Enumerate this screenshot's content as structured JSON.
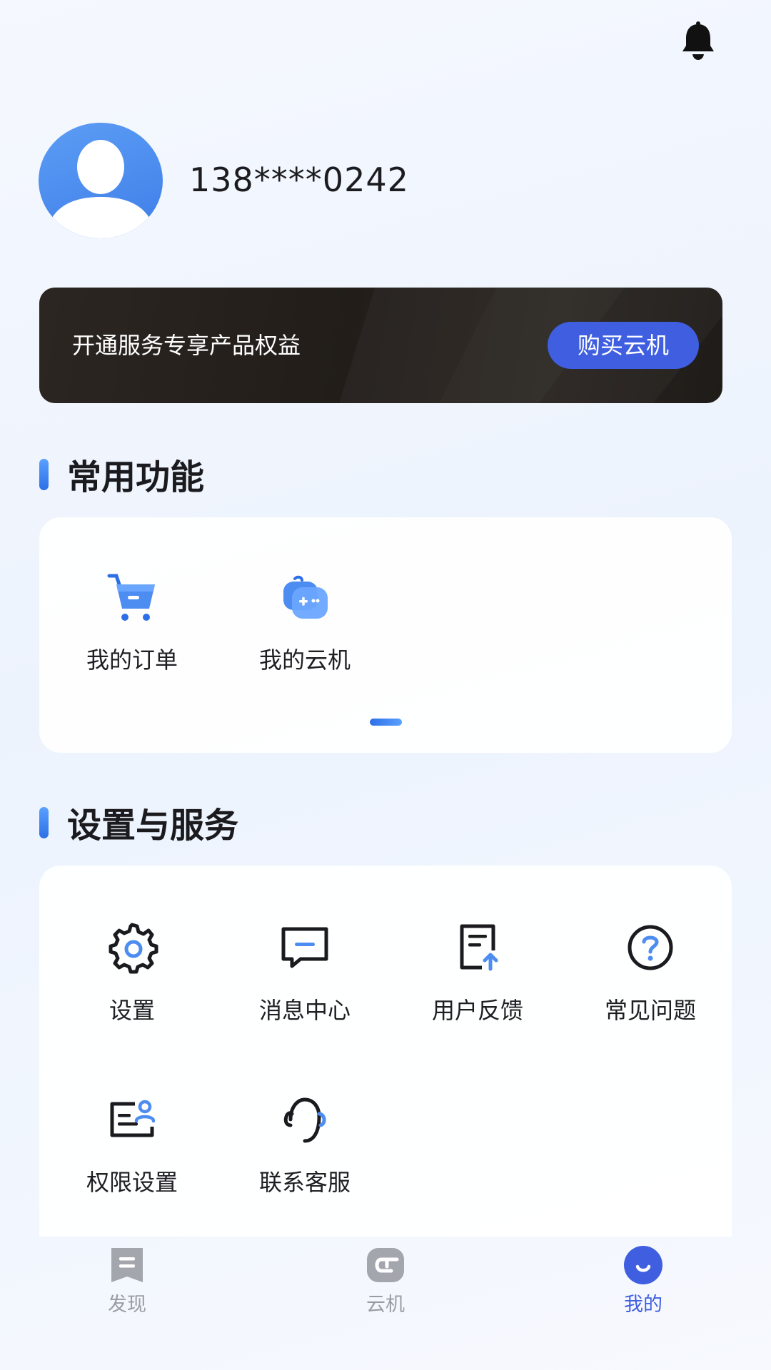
{
  "header": {
    "notification_icon": "bell-icon",
    "user": {
      "phone": "138****0242",
      "avatar_icon": "user-avatar-icon"
    }
  },
  "banner": {
    "text": "开通服务专享产品权益",
    "button_label": "购买云机"
  },
  "common_functions": {
    "title": "常用功能",
    "items": [
      {
        "label": "我的订单",
        "icon": "shopping-cart-icon"
      },
      {
        "label": "我的云机",
        "icon": "gamepad-icon"
      }
    ],
    "page_indicator": {
      "pages": 1,
      "current": 1
    }
  },
  "settings_services": {
    "title": "设置与服务",
    "items": [
      {
        "label": "设置",
        "icon": "gear-icon"
      },
      {
        "label": "消息中心",
        "icon": "message-icon"
      },
      {
        "label": "用户反馈",
        "icon": "feedback-icon"
      },
      {
        "label": "常见问题",
        "icon": "question-icon"
      },
      {
        "label": "权限设置",
        "icon": "permission-icon"
      },
      {
        "label": "联系客服",
        "icon": "headset-icon"
      }
    ]
  },
  "tabbar": {
    "tabs": [
      {
        "label": "发现",
        "icon": "discover-icon",
        "active": false
      },
      {
        "label": "云机",
        "icon": "cloud-phone-icon",
        "active": false
      },
      {
        "label": "我的",
        "icon": "profile-icon",
        "active": true
      }
    ]
  },
  "colors": {
    "accent": "#3f5fe0",
    "accent_light": "#5aa1ff",
    "banner_bg": "#221d19",
    "tab_inactive": "#9a9ca3"
  }
}
